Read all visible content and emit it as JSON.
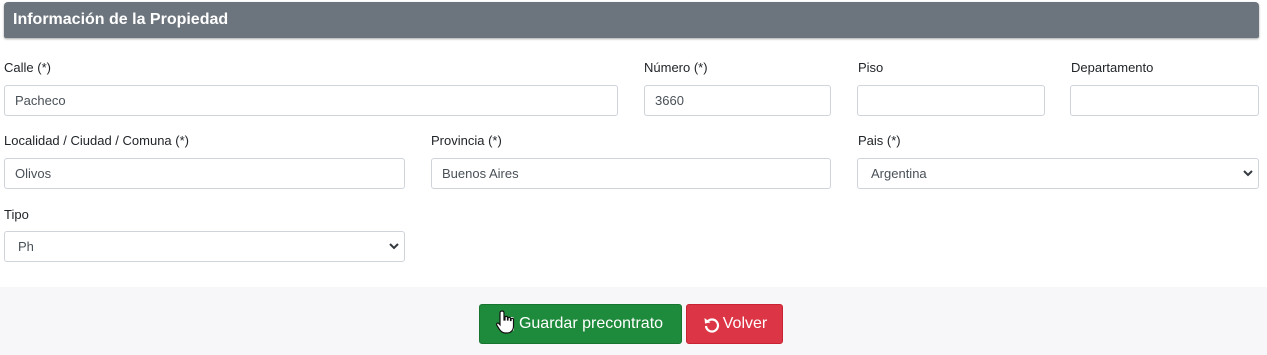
{
  "section": {
    "title": "Información de la Propiedad"
  },
  "fields": {
    "calle": {
      "label": "Calle (*)",
      "value": "Pacheco"
    },
    "numero": {
      "label": "Número (*)",
      "value": "3660"
    },
    "piso": {
      "label": "Piso",
      "value": ""
    },
    "departamento": {
      "label": "Departamento",
      "value": ""
    },
    "localidad": {
      "label": "Localidad / Ciudad / Comuna (*)",
      "value": "Olivos"
    },
    "provincia": {
      "label": "Provincia (*)",
      "value": "Buenos Aires"
    },
    "pais": {
      "label": "Pais (*)",
      "value": "Argentina"
    },
    "tipo": {
      "label": "Tipo",
      "value": "Ph"
    }
  },
  "actions": {
    "save_label": "Guardar precontrato",
    "back_label": "Volver"
  },
  "colors": {
    "header": "#6c757d",
    "save": "#1e8a3b",
    "back": "#dc3545"
  },
  "icons": {
    "save": "floppy-disk-icon",
    "back": "undo-icon",
    "cursor": "hand-pointer-icon"
  }
}
